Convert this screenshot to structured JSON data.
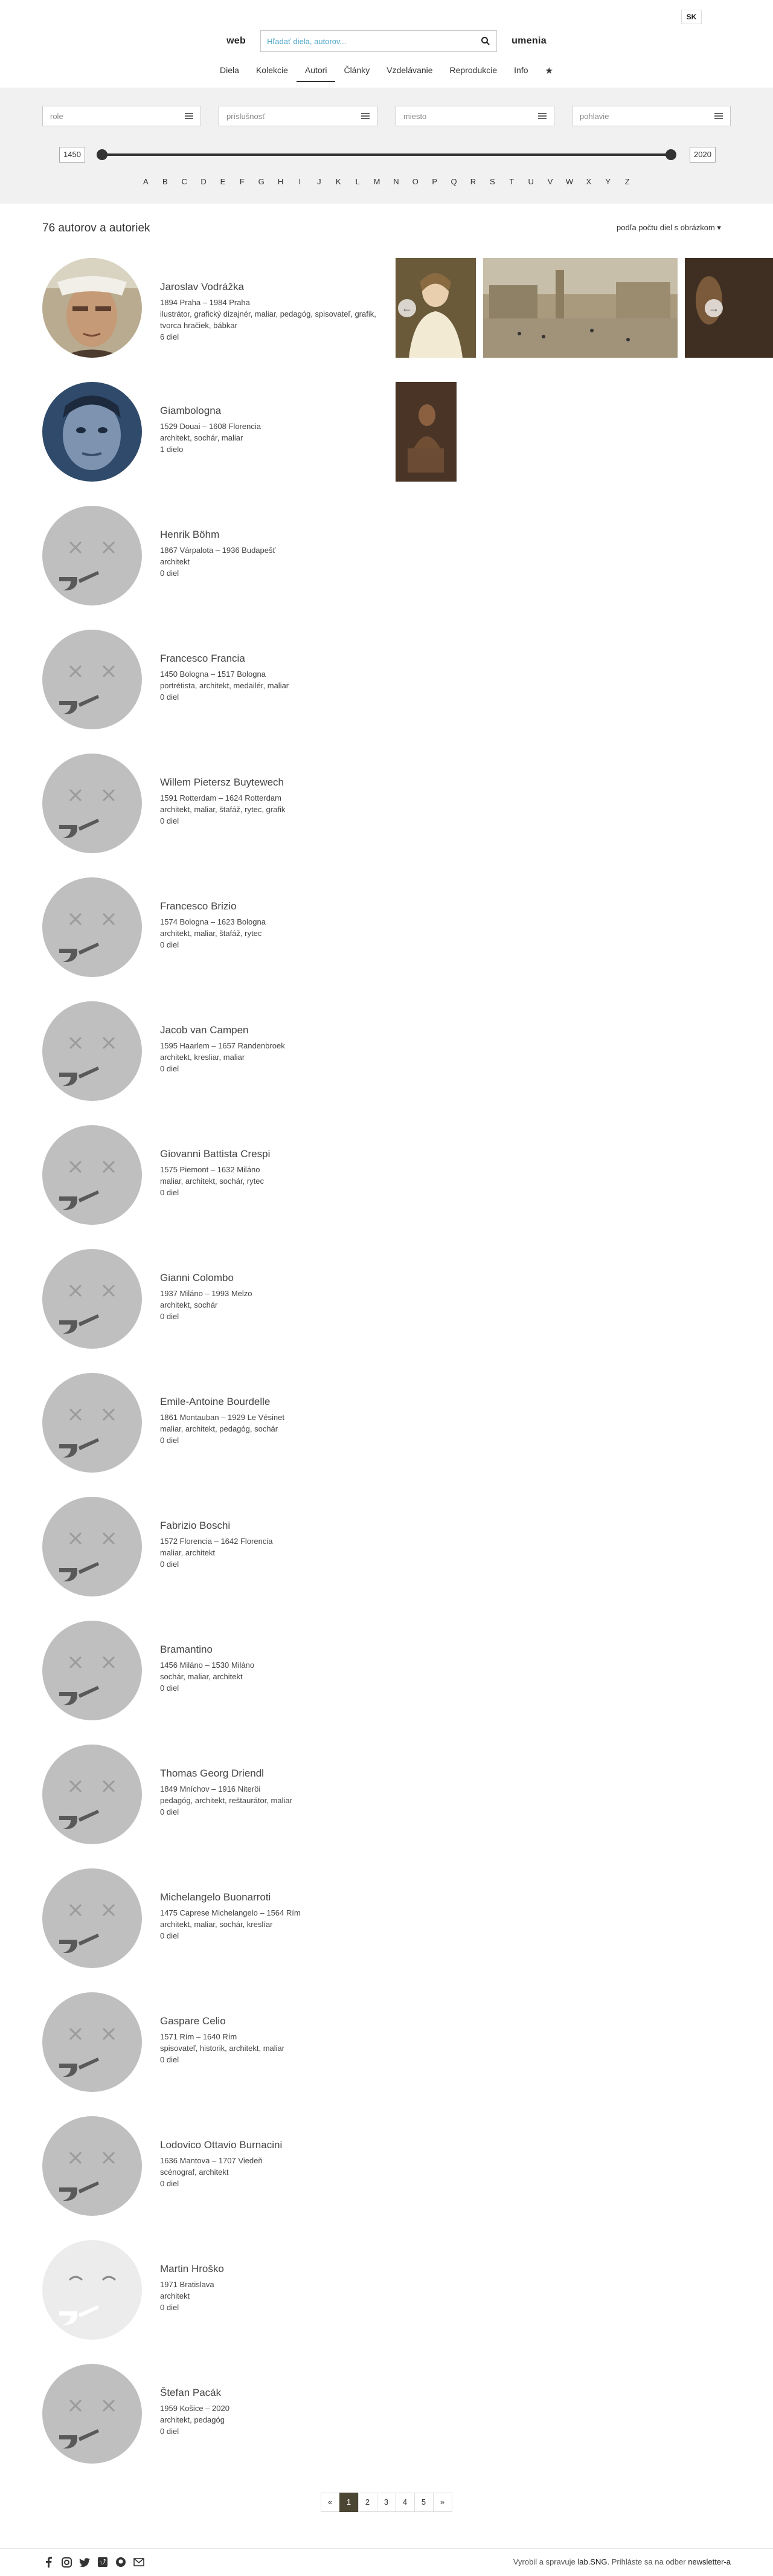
{
  "header": {
    "lang": "SK",
    "brand_left": "web",
    "brand_right": "umenia",
    "search_placeholder": "Hľadať diela, autorov..."
  },
  "nav": {
    "items": [
      "Diela",
      "Kolekcie",
      "Autori",
      "Články",
      "Vzdelávanie",
      "Reprodukcie",
      "Info"
    ],
    "active": "Autori",
    "star": "★"
  },
  "filters": {
    "selects": [
      "role",
      "príslušnosť",
      "miesto",
      "pohlavie"
    ],
    "year_from": "1450",
    "year_to": "2020",
    "alphabet": [
      "A",
      "B",
      "C",
      "D",
      "E",
      "F",
      "G",
      "H",
      "I",
      "J",
      "K",
      "L",
      "M",
      "N",
      "O",
      "P",
      "Q",
      "R",
      "S",
      "T",
      "U",
      "V",
      "W",
      "X",
      "Y",
      "Z"
    ]
  },
  "results": {
    "count_label": "76 autorov a autoriek",
    "sort_label": "podľa počtu diel s obrázkom ▾"
  },
  "authors": [
    {
      "name": "Jaroslav Vodrážka",
      "life": "1894 Praha – 1984 Praha",
      "roles": "ilustrátor, grafický dizajnér, maliar, pedagóg, spisovateľ, grafik, tvorca hračiek, bábkar",
      "works": "6 diel"
    },
    {
      "name": "Giambologna",
      "life": "1529 Douai – 1608 Florencia",
      "roles": "architekt, sochár, maliar",
      "works": "1 dielo"
    },
    {
      "name": "Henrik Böhm",
      "life": "1867 Várpalota – 1936 Budapešť",
      "roles": "architekt",
      "works": "0 diel"
    },
    {
      "name": "Francesco Francia",
      "life": "1450 Bologna – 1517 Bologna",
      "roles": "portrétista, architekt, medailér, maliar",
      "works": "0 diel"
    },
    {
      "name": "Willem Pietersz Buytewech",
      "life": "1591 Rotterdam – 1624 Rotterdam",
      "roles": "architekt, maliar, štafáž, rytec, grafik",
      "works": "0 diel"
    },
    {
      "name": "Francesco Brizio",
      "life": "1574 Bologna – 1623 Bologna",
      "roles": "architekt, maliar, štafáž, rytec",
      "works": "0 diel"
    },
    {
      "name": "Jacob van Campen",
      "life": "1595 Haarlem – 1657 Randenbroek",
      "roles": "architekt, kresliar, maliar",
      "works": "0 diel"
    },
    {
      "name": "Giovanni Battista Crespi",
      "life": "1575 Piemont – 1632 Miláno",
      "roles": "maliar, architekt, sochár, rytec",
      "works": "0 diel"
    },
    {
      "name": "Gianni Colombo",
      "life": "1937 Miláno – 1993 Melzo",
      "roles": "architekt, sochár",
      "works": "0 diel"
    },
    {
      "name": "Emile-Antoine Bourdelle",
      "life": "1861 Montauban – 1929 Le Vésinet",
      "roles": "maliar, architekt, pedagóg, sochár",
      "works": "0 diel"
    },
    {
      "name": "Fabrizio Boschi",
      "life": "1572 Florencia – 1642 Florencia",
      "roles": "maliar, architekt",
      "works": "0 diel"
    },
    {
      "name": "Bramantino",
      "life": "1456 Miláno – 1530 Miláno",
      "roles": "sochár, maliar, architekt",
      "works": "0 diel"
    },
    {
      "name": "Thomas Georg Driendl",
      "life": "1849 Mníchov – 1916 Niteröi",
      "roles": "pedagóg, architekt, reštaurátor, maliar",
      "works": "0 diel"
    },
    {
      "name": "Michelangelo Buonarroti",
      "life": "1475 Caprese Michelangelo – 1564 Rím",
      "roles": "architekt, maliar, sochár, kreslíar",
      "works": "0 diel"
    },
    {
      "name": "Gaspare Celio",
      "life": "1571 Rím – 1640 Rím",
      "roles": "spisovateľ, historik, architekt, maliar",
      "works": "0 diel"
    },
    {
      "name": "Lodovico Ottavio Burnacini",
      "life": "1636 Mantova – 1707 Viedeň",
      "roles": "scénograf, architekt",
      "works": "0 diel"
    },
    {
      "name": "Martin Hroško",
      "life": "1971 Bratislava",
      "roles": "architekt",
      "works": "0 diel"
    },
    {
      "name": "Štefan Pacák",
      "life": "1959 Košice – 2020",
      "roles": "architekt, pedagóg",
      "works": "0 diel"
    }
  ],
  "pager": {
    "prev": "«",
    "pages": [
      "1",
      "2",
      "3",
      "4",
      "5"
    ],
    "active": "1",
    "next": "»"
  },
  "footer": {
    "credits_prefix": "Vyrobil a spravuje",
    "credits_org": "lab.SNG",
    "credits_middle": ". Prihláste sa na odber",
    "credits_link": "newsletter-a",
    "icons": [
      "facebook-icon",
      "instagram-icon",
      "twitter-icon",
      "vimeo-icon",
      "github-icon",
      "mail-icon"
    ]
  }
}
